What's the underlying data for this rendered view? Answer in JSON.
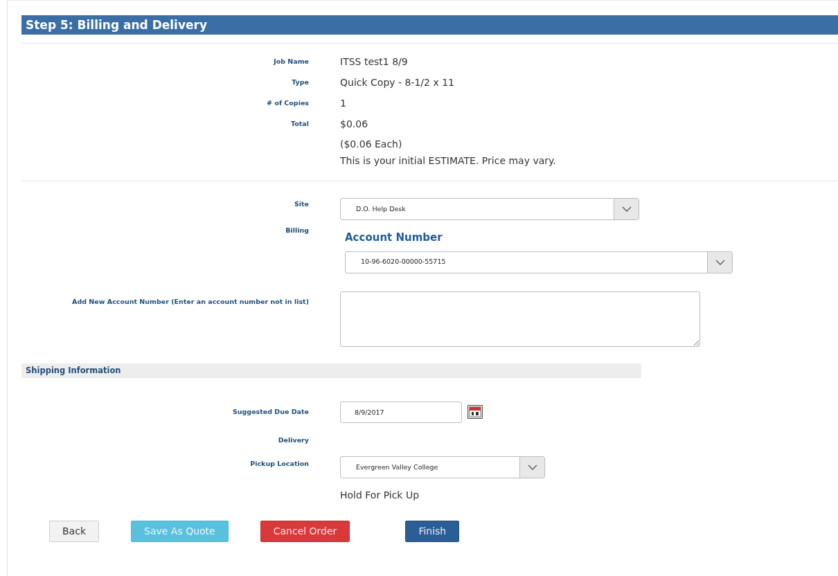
{
  "header": {
    "title": "Step 5: Billing and Delivery"
  },
  "summary": [
    {
      "label": "Job Name",
      "value": "ITSS test1 8/9"
    },
    {
      "label": "Type",
      "value": "Quick Copy - 8-1/2 x 11"
    },
    {
      "label": "# of Copies",
      "value": "1"
    },
    {
      "label": "Total",
      "value": "$0.06"
    }
  ],
  "summary_notes": [
    "($0.06 Each)",
    "This is your initial ESTIMATE. Price may vary."
  ],
  "site": {
    "label": "Site",
    "value": "D.O. Help Desk"
  },
  "billing": {
    "label": "Billing",
    "heading": "Account Number",
    "value": "10-96-6020-00000-55715"
  },
  "new_account": {
    "label": "Add New Account Number (Enter an account number not in list)"
  },
  "shipping": {
    "title": "Shipping Information",
    "due_date": {
      "label": "Suggested Due Date",
      "value": "8/9/2017"
    },
    "delivery": {
      "label": "Delivery"
    },
    "pickup": {
      "label": "Pickup Location",
      "value": "Evergreen Valley College"
    },
    "note": "Hold For Pick Up"
  },
  "buttons": [
    {
      "label": "Back",
      "kind": "default"
    },
    {
      "label": "Save As Quote",
      "kind": "info"
    },
    {
      "label": "Cancel Order",
      "kind": "danger"
    },
    {
      "label": "Finish",
      "kind": "primary"
    }
  ]
}
